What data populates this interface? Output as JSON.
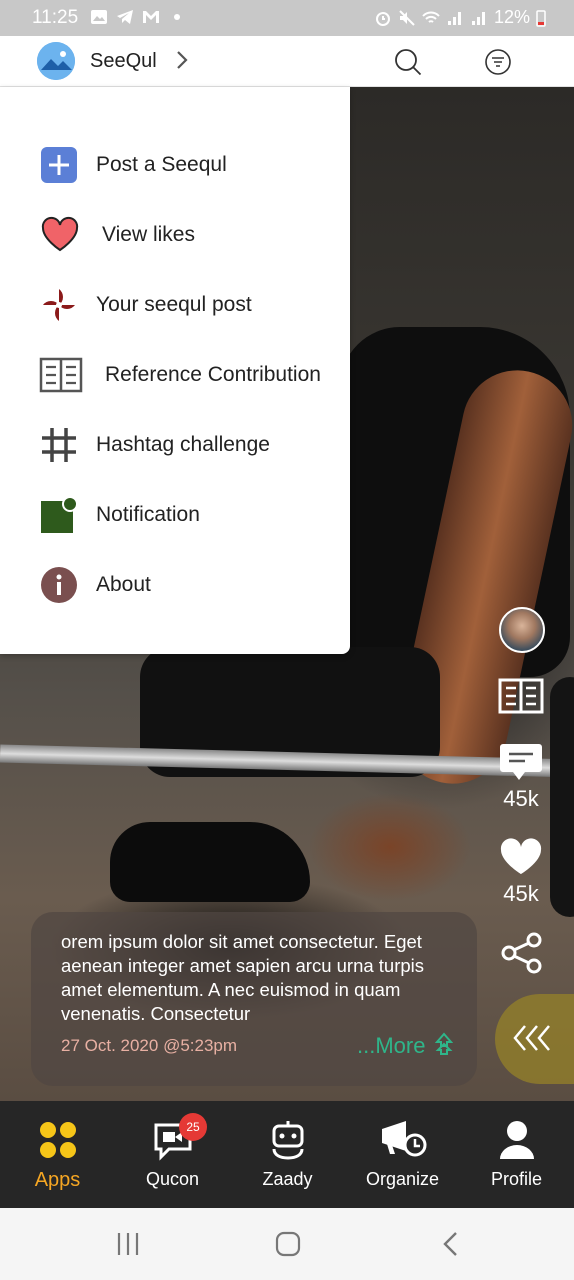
{
  "status_bar": {
    "time": "11:25",
    "battery": "12%"
  },
  "header": {
    "brand": "SeeQul",
    "icons": [
      "photo-logo-icon",
      "chevron-right-icon",
      "search-icon",
      "filter-icon"
    ]
  },
  "menu": {
    "items": [
      {
        "label": "Post a Seequl",
        "icon": "plus-square-icon"
      },
      {
        "label": "View likes",
        "icon": "heart-icon"
      },
      {
        "label": "Your seequl post",
        "icon": "pinwheel-icon"
      },
      {
        "label": "Reference Contribution",
        "icon": "book-icon"
      },
      {
        "label": "Hashtag challenge",
        "icon": "hashtag-icon"
      },
      {
        "label": "Notification",
        "icon": "notification-icon"
      },
      {
        "label": "About",
        "icon": "info-icon"
      }
    ]
  },
  "rail": {
    "comments_count": "45k",
    "likes_count": "45k"
  },
  "post": {
    "caption": "orem ipsum dolor sit amet consectetur. Eget aenean integer amet sapien arcu urna turpis amet elementum. A nec euismod in quam venenatis. Consectetur",
    "date": "27 Oct. 2020 @5:23pm",
    "more": "...More"
  },
  "bottom_nav": {
    "items": [
      {
        "label": "Apps",
        "icon": "apps-grid-icon",
        "active": true
      },
      {
        "label": "Qucon",
        "icon": "video-chat-icon",
        "badge": "25"
      },
      {
        "label": "Zaady",
        "icon": "robot-icon"
      },
      {
        "label": "Organize",
        "icon": "megaphone-clock-icon"
      },
      {
        "label": "Profile",
        "icon": "person-icon"
      }
    ]
  },
  "colors": {
    "accent_orange": "#f5a623",
    "more_green": "#2fb58a",
    "badge_red": "#e53935",
    "nav_bg": "#262626"
  }
}
